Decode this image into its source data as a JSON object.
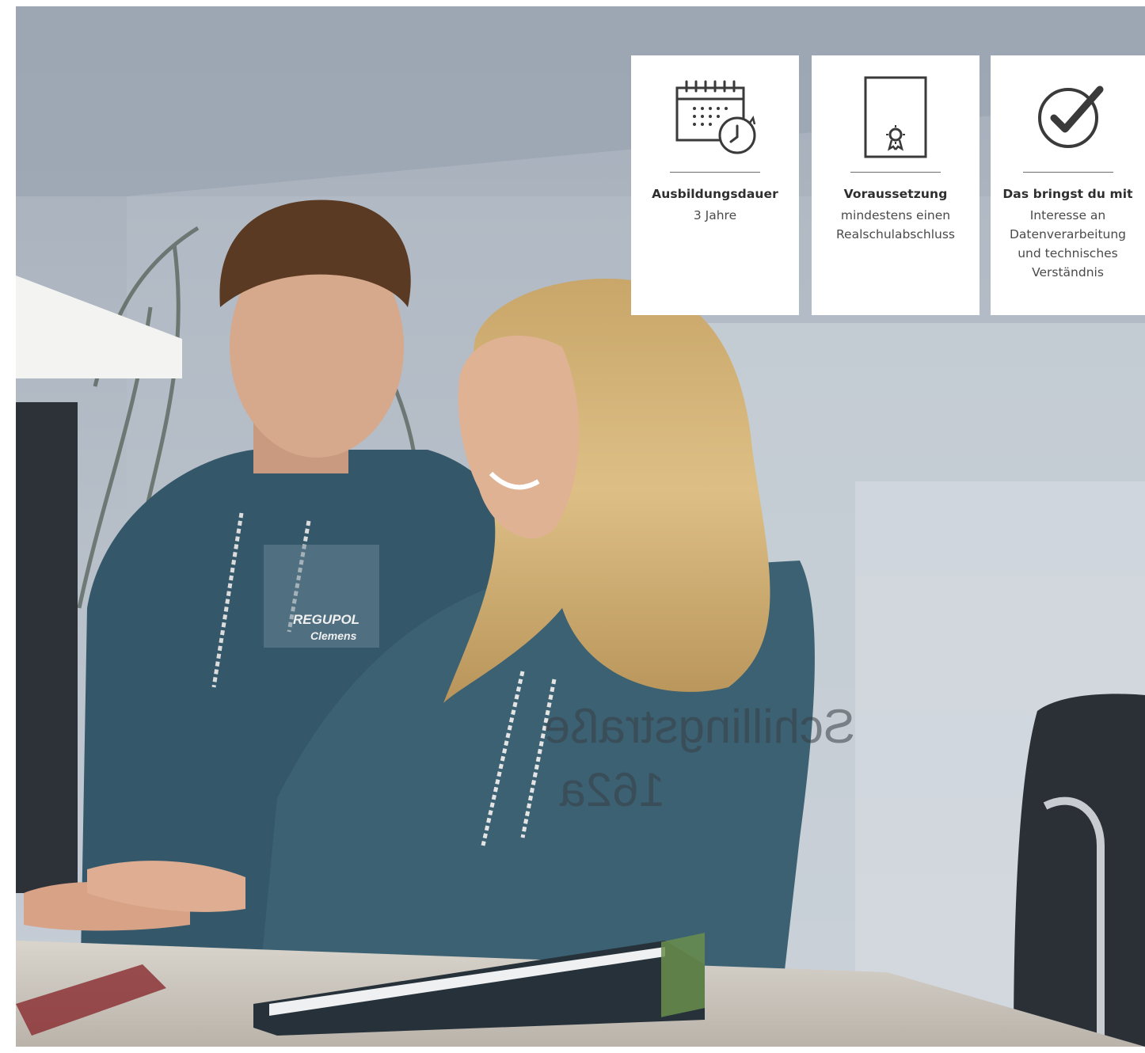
{
  "photo": {
    "badge_brand": "REGUPOL",
    "badge_name": "Clemens",
    "glass_text_line1": "Schillingstraße",
    "glass_text_line2": "162a"
  },
  "cards": [
    {
      "icon": "calendar-clock-icon",
      "title": "Ausbildungsdauer",
      "text": "3 Jahre"
    },
    {
      "icon": "certificate-icon",
      "title": "Voraussetzung",
      "text": "mindestens einen\nRealschulabschluss"
    },
    {
      "icon": "check-circle-icon",
      "title": "Das bringst du mit",
      "text": "Interesse an\nDatenverarbeitung\nund technisches\nVerständnis"
    }
  ],
  "colors": {
    "card_bg": "#ffffff",
    "hoodie": "#35586a",
    "icon_stroke": "#3a3a3a"
  }
}
